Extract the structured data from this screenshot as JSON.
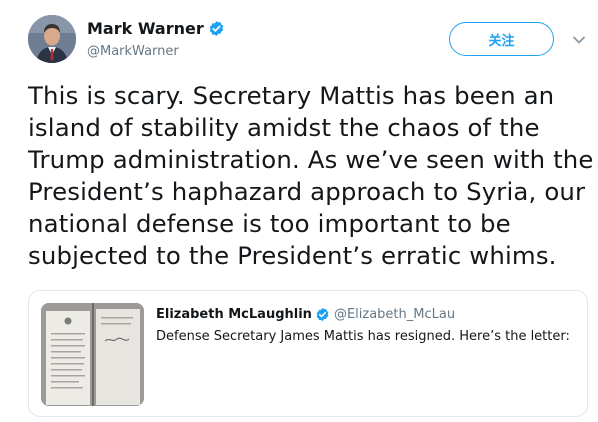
{
  "author": {
    "display_name": "Mark Warner",
    "handle": "@MarkWarner",
    "verified": true,
    "avatar_icon": "avatar-photo"
  },
  "actions": {
    "follow_label": "关注",
    "more_icon": "chevron-down-icon"
  },
  "tweet": {
    "lines": [
      "This is scary. Secretary Mattis has been an",
      "island of stability amidst the chaos of the",
      "Trump administration. As we’ve seen with the",
      "President’s haphazard approach to Syria, our",
      "national defense is too important to be",
      "subjected to the President’s erratic whims."
    ]
  },
  "quoted_tweet": {
    "display_name": "Elizabeth McLaughlin",
    "handle": "@Elizabeth_McLau",
    "verified": true,
    "text": "Defense Secretary James Mattis has resigned. Here’s the letter:",
    "thumbnail_icon": "letter-photo"
  },
  "colors": {
    "accent": "#1da1f2",
    "text": "#14171a",
    "secondary_text": "#657786",
    "border": "#e1e8ed"
  }
}
